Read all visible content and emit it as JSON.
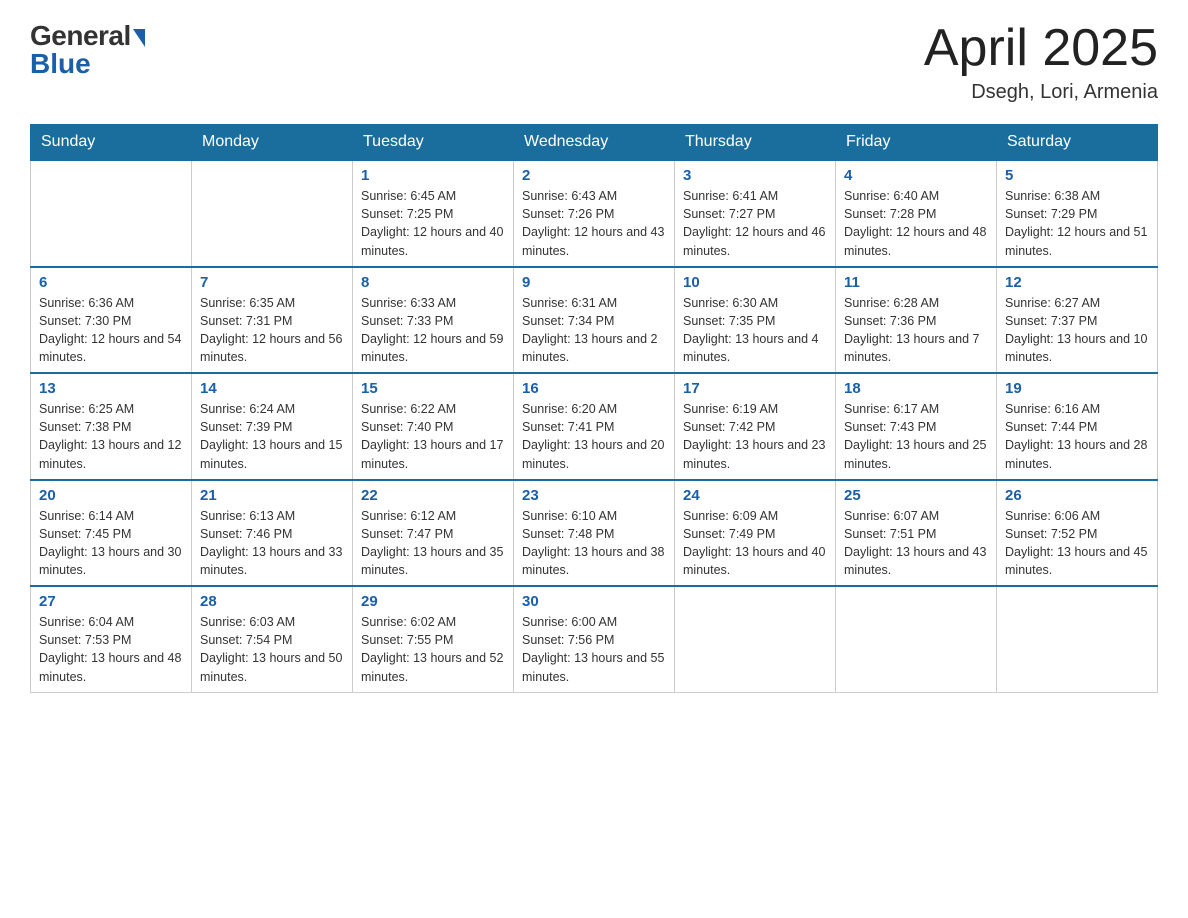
{
  "header": {
    "logo_general": "General",
    "logo_blue": "Blue",
    "month_title": "April 2025",
    "location": "Dsegh, Lori, Armenia"
  },
  "days_of_week": [
    "Sunday",
    "Monday",
    "Tuesday",
    "Wednesday",
    "Thursday",
    "Friday",
    "Saturday"
  ],
  "weeks": [
    [
      {
        "day": "",
        "sunrise": "",
        "sunset": "",
        "daylight": ""
      },
      {
        "day": "",
        "sunrise": "",
        "sunset": "",
        "daylight": ""
      },
      {
        "day": "1",
        "sunrise": "Sunrise: 6:45 AM",
        "sunset": "Sunset: 7:25 PM",
        "daylight": "Daylight: 12 hours and 40 minutes."
      },
      {
        "day": "2",
        "sunrise": "Sunrise: 6:43 AM",
        "sunset": "Sunset: 7:26 PM",
        "daylight": "Daylight: 12 hours and 43 minutes."
      },
      {
        "day": "3",
        "sunrise": "Sunrise: 6:41 AM",
        "sunset": "Sunset: 7:27 PM",
        "daylight": "Daylight: 12 hours and 46 minutes."
      },
      {
        "day": "4",
        "sunrise": "Sunrise: 6:40 AM",
        "sunset": "Sunset: 7:28 PM",
        "daylight": "Daylight: 12 hours and 48 minutes."
      },
      {
        "day": "5",
        "sunrise": "Sunrise: 6:38 AM",
        "sunset": "Sunset: 7:29 PM",
        "daylight": "Daylight: 12 hours and 51 minutes."
      }
    ],
    [
      {
        "day": "6",
        "sunrise": "Sunrise: 6:36 AM",
        "sunset": "Sunset: 7:30 PM",
        "daylight": "Daylight: 12 hours and 54 minutes."
      },
      {
        "day": "7",
        "sunrise": "Sunrise: 6:35 AM",
        "sunset": "Sunset: 7:31 PM",
        "daylight": "Daylight: 12 hours and 56 minutes."
      },
      {
        "day": "8",
        "sunrise": "Sunrise: 6:33 AM",
        "sunset": "Sunset: 7:33 PM",
        "daylight": "Daylight: 12 hours and 59 minutes."
      },
      {
        "day": "9",
        "sunrise": "Sunrise: 6:31 AM",
        "sunset": "Sunset: 7:34 PM",
        "daylight": "Daylight: 13 hours and 2 minutes."
      },
      {
        "day": "10",
        "sunrise": "Sunrise: 6:30 AM",
        "sunset": "Sunset: 7:35 PM",
        "daylight": "Daylight: 13 hours and 4 minutes."
      },
      {
        "day": "11",
        "sunrise": "Sunrise: 6:28 AM",
        "sunset": "Sunset: 7:36 PM",
        "daylight": "Daylight: 13 hours and 7 minutes."
      },
      {
        "day": "12",
        "sunrise": "Sunrise: 6:27 AM",
        "sunset": "Sunset: 7:37 PM",
        "daylight": "Daylight: 13 hours and 10 minutes."
      }
    ],
    [
      {
        "day": "13",
        "sunrise": "Sunrise: 6:25 AM",
        "sunset": "Sunset: 7:38 PM",
        "daylight": "Daylight: 13 hours and 12 minutes."
      },
      {
        "day": "14",
        "sunrise": "Sunrise: 6:24 AM",
        "sunset": "Sunset: 7:39 PM",
        "daylight": "Daylight: 13 hours and 15 minutes."
      },
      {
        "day": "15",
        "sunrise": "Sunrise: 6:22 AM",
        "sunset": "Sunset: 7:40 PM",
        "daylight": "Daylight: 13 hours and 17 minutes."
      },
      {
        "day": "16",
        "sunrise": "Sunrise: 6:20 AM",
        "sunset": "Sunset: 7:41 PM",
        "daylight": "Daylight: 13 hours and 20 minutes."
      },
      {
        "day": "17",
        "sunrise": "Sunrise: 6:19 AM",
        "sunset": "Sunset: 7:42 PM",
        "daylight": "Daylight: 13 hours and 23 minutes."
      },
      {
        "day": "18",
        "sunrise": "Sunrise: 6:17 AM",
        "sunset": "Sunset: 7:43 PM",
        "daylight": "Daylight: 13 hours and 25 minutes."
      },
      {
        "day": "19",
        "sunrise": "Sunrise: 6:16 AM",
        "sunset": "Sunset: 7:44 PM",
        "daylight": "Daylight: 13 hours and 28 minutes."
      }
    ],
    [
      {
        "day": "20",
        "sunrise": "Sunrise: 6:14 AM",
        "sunset": "Sunset: 7:45 PM",
        "daylight": "Daylight: 13 hours and 30 minutes."
      },
      {
        "day": "21",
        "sunrise": "Sunrise: 6:13 AM",
        "sunset": "Sunset: 7:46 PM",
        "daylight": "Daylight: 13 hours and 33 minutes."
      },
      {
        "day": "22",
        "sunrise": "Sunrise: 6:12 AM",
        "sunset": "Sunset: 7:47 PM",
        "daylight": "Daylight: 13 hours and 35 minutes."
      },
      {
        "day": "23",
        "sunrise": "Sunrise: 6:10 AM",
        "sunset": "Sunset: 7:48 PM",
        "daylight": "Daylight: 13 hours and 38 minutes."
      },
      {
        "day": "24",
        "sunrise": "Sunrise: 6:09 AM",
        "sunset": "Sunset: 7:49 PM",
        "daylight": "Daylight: 13 hours and 40 minutes."
      },
      {
        "day": "25",
        "sunrise": "Sunrise: 6:07 AM",
        "sunset": "Sunset: 7:51 PM",
        "daylight": "Daylight: 13 hours and 43 minutes."
      },
      {
        "day": "26",
        "sunrise": "Sunrise: 6:06 AM",
        "sunset": "Sunset: 7:52 PM",
        "daylight": "Daylight: 13 hours and 45 minutes."
      }
    ],
    [
      {
        "day": "27",
        "sunrise": "Sunrise: 6:04 AM",
        "sunset": "Sunset: 7:53 PM",
        "daylight": "Daylight: 13 hours and 48 minutes."
      },
      {
        "day": "28",
        "sunrise": "Sunrise: 6:03 AM",
        "sunset": "Sunset: 7:54 PM",
        "daylight": "Daylight: 13 hours and 50 minutes."
      },
      {
        "day": "29",
        "sunrise": "Sunrise: 6:02 AM",
        "sunset": "Sunset: 7:55 PM",
        "daylight": "Daylight: 13 hours and 52 minutes."
      },
      {
        "day": "30",
        "sunrise": "Sunrise: 6:00 AM",
        "sunset": "Sunset: 7:56 PM",
        "daylight": "Daylight: 13 hours and 55 minutes."
      },
      {
        "day": "",
        "sunrise": "",
        "sunset": "",
        "daylight": ""
      },
      {
        "day": "",
        "sunrise": "",
        "sunset": "",
        "daylight": ""
      },
      {
        "day": "",
        "sunrise": "",
        "sunset": "",
        "daylight": ""
      }
    ]
  ]
}
